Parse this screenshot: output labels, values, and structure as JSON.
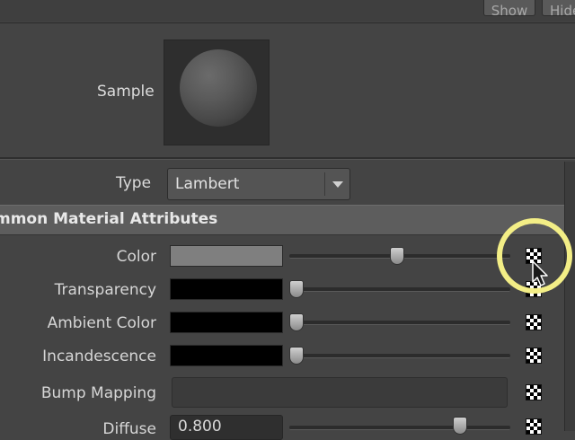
{
  "header": {
    "buttons": [
      {
        "label": "Show"
      },
      {
        "label": "Hide"
      }
    ]
  },
  "sample": {
    "label": "Sample"
  },
  "type": {
    "label": "Type",
    "value": "Lambert"
  },
  "section": {
    "title": "Common Material Attributes",
    "visible_title": "mmon Material Attributes"
  },
  "attributes": [
    {
      "label": "Color",
      "swatch_color": "#7f7f7f",
      "slider": 0.5
    },
    {
      "label": "Transparency",
      "swatch_color": "#000000",
      "slider": 0.0
    },
    {
      "label": "Ambient Color",
      "swatch_color": "#000000",
      "slider": 0.0
    },
    {
      "label": "Incandescence",
      "swatch_color": "#000000",
      "slider": 0.0
    },
    {
      "label": "Bump Mapping"
    },
    {
      "label": "Diffuse",
      "value": "0.800",
      "slider": 0.8
    }
  ],
  "icons": {
    "map_button": "checker-map-icon",
    "dropdown": "chevron-down-icon",
    "cursor": "mouse-pointer-icon"
  },
  "colors": {
    "panel_bg": "#444444",
    "header_bg": "#5d5d5d",
    "highlight_ring": "#f3ee86"
  }
}
